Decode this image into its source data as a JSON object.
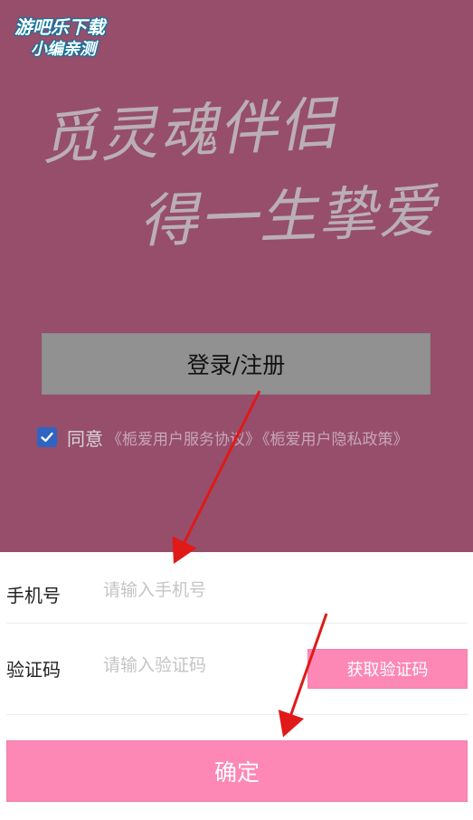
{
  "watermark": {
    "line1": "游吧乐下载",
    "line2": "小编亲测"
  },
  "slogan": {
    "line1": "觅灵魂伴侣",
    "line2": "得一生挚爱"
  },
  "login_register_label": "登录/注册",
  "agreement": {
    "agree_label": "同意",
    "service_link": "《栀爱用户服务协议》",
    "privacy_link": "《栀爱用户隐私政策》"
  },
  "form": {
    "phone_label": "手机号",
    "phone_placeholder": "请输入手机号",
    "code_label": "验证码",
    "code_placeholder": "请输入验证码",
    "get_code_label": "获取验证码",
    "confirm_label": "确定"
  },
  "colors": {
    "top_bg": "#964e6b",
    "accent_pink": "#fd88b5",
    "checkbox_blue": "#2f64c2",
    "arrow_red": "#e01919"
  }
}
